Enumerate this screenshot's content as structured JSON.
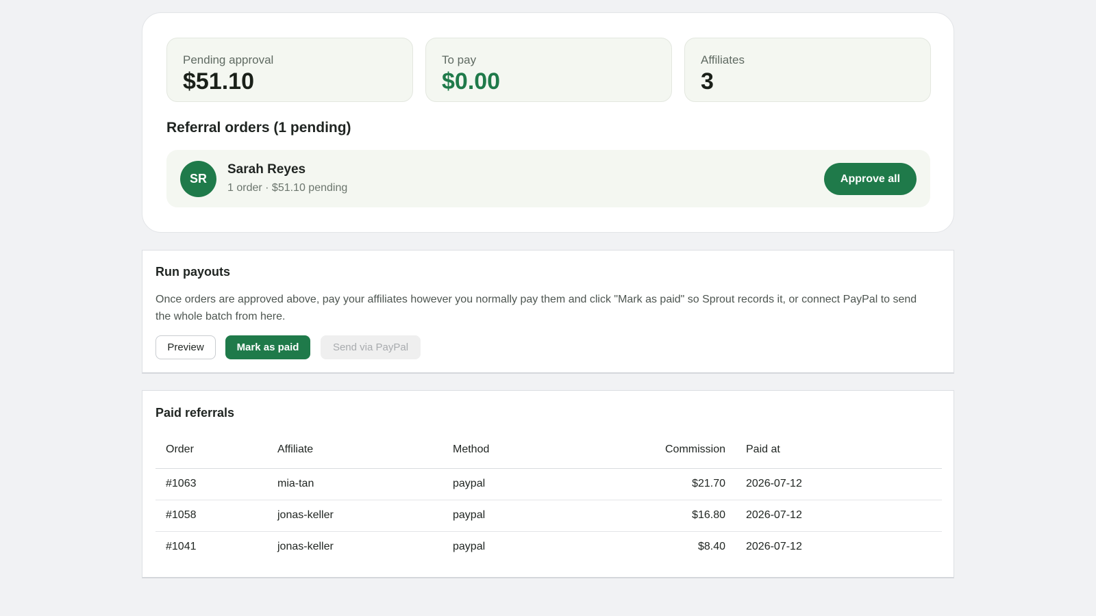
{
  "summary": {
    "pending_label": "Pending approval",
    "pending_value": "$51.10",
    "topay_label": "To pay",
    "topay_value": "$0.00",
    "affiliates_label": "Affiliates",
    "affiliates_value": "3"
  },
  "referral_orders": {
    "heading": "Referral orders (1 pending)",
    "items": [
      {
        "initials": "SR",
        "name": "Sarah Reyes",
        "detail": "1 order · $51.10 pending",
        "action_label": "Approve all"
      }
    ]
  },
  "payouts": {
    "title": "Run payouts",
    "description": "Once orders are approved above, pay your affiliates however you normally pay them and click \"Mark as paid\" so Sprout records it, or connect PayPal to send the whole batch from here.",
    "preview_label": "Preview",
    "mark_paid_label": "Mark as paid",
    "paypal_label": "Send via PayPal"
  },
  "paid_referrals": {
    "title": "Paid referrals",
    "columns": [
      "Order",
      "Affiliate",
      "Method",
      "Commission",
      "Paid at"
    ],
    "rows": [
      {
        "order": "#1063",
        "affiliate": "mia-tan",
        "method": "paypal",
        "commission": "$21.70",
        "paid_at": "2026-07-12"
      },
      {
        "order": "#1058",
        "affiliate": "jonas-keller",
        "method": "paypal",
        "commission": "$16.80",
        "paid_at": "2026-07-12"
      },
      {
        "order": "#1041",
        "affiliate": "jonas-keller",
        "method": "paypal",
        "commission": "$8.40",
        "paid_at": "2026-07-12"
      }
    ]
  },
  "colors": {
    "accent": "#1f7a4a",
    "stat_bg": "#f4f7f1",
    "page_bg": "#f1f2f4"
  }
}
